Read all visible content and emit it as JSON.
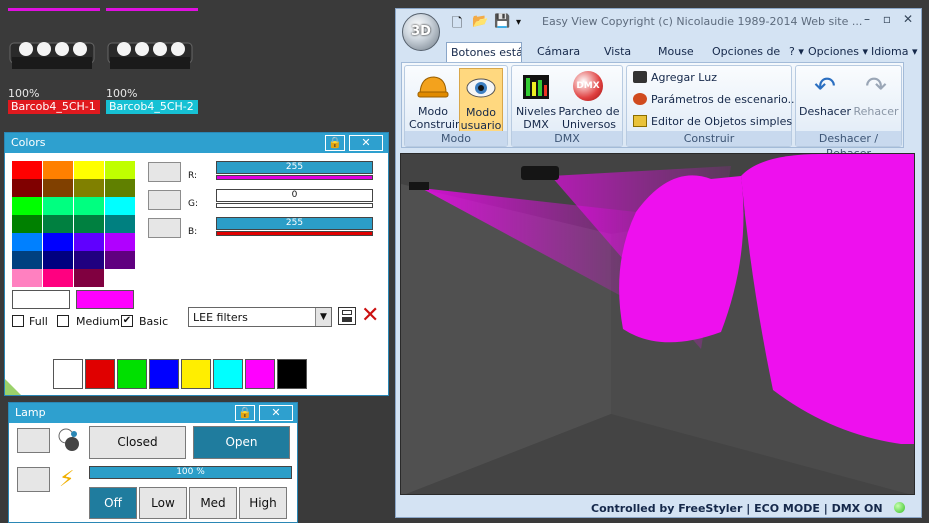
{
  "fixtures": [
    {
      "percent": "100%",
      "name": "Barcob4_5CH-1",
      "label_color": "#e0191e"
    },
    {
      "percent": "100%",
      "name": "Barcob4_5CH-2",
      "label_color": "#17c1d4"
    }
  ],
  "colors_panel": {
    "title": "Colors",
    "pin_icon": "lock-icon",
    "close_label": "✕",
    "palette": [
      "#ff0000",
      "#ff8000",
      "#ffff00",
      "#c0ff00",
      "#800000",
      "#804000",
      "#808000",
      "#608000",
      "#00ff00",
      "#00ff80",
      "#00ff80",
      "#00ffff",
      "#008000",
      "#008040",
      "#008040",
      "#008080",
      "#0080ff",
      "#0000ff",
      "#6000ff",
      "#b000ff",
      "#004080",
      "#000080",
      "#200080",
      "#600080",
      "#ff80c0",
      "#ff0080",
      "#800040",
      "#ffffff"
    ],
    "r_label": "R:",
    "g_label": "G:",
    "b_label": "B:",
    "r_value": "255",
    "g_value": "0",
    "b_value": "255",
    "current_color": "#ff00ff",
    "checkboxes": [
      {
        "label": "Full",
        "checked": false
      },
      {
        "label": "Medium",
        "checked": false
      },
      {
        "label": "Basic",
        "checked": true
      }
    ],
    "filter_select": "LEE filters",
    "quick_colors": [
      "#ffffff",
      "#e00000",
      "#00e000",
      "#0000ff",
      "#ffee00",
      "#00ffff",
      "#ff00ff",
      "#000000"
    ]
  },
  "lamp_panel": {
    "title": "Lamp",
    "closed_label": "Closed",
    "open_label": "Open",
    "progress": "100 %",
    "off_label": "Off",
    "low_label": "Low",
    "med_label": "Med",
    "high_label": "High"
  },
  "window": {
    "orb_label": "3D",
    "title": "Easy View   Copyright (c) Nicolaudie 1989-2014   Web site ...",
    "tabs": [
      "Botones están",
      "Cámara",
      "Vista",
      "Mouse",
      "Opciones de c"
    ],
    "right_menu": [
      "?",
      "Opciones",
      "Idioma"
    ],
    "groups": {
      "modo": {
        "caption": "Modo",
        "construir": "Modo\nConstruir",
        "usuario": "Modo\nusuario"
      },
      "dmx": {
        "caption": "DMX",
        "niveles": "Niveles\nDMX",
        "parcheo": "Parcheo de\nUniversos",
        "dmx_logo": "DMX"
      },
      "construir": {
        "caption": "Construir",
        "items": [
          "Agregar Luz",
          "Parámetros de escenario...",
          "Editor de Objetos simples"
        ]
      },
      "deshacer": {
        "caption": "Deshacer / Rehacer",
        "undo": "Deshacer",
        "redo": "Rehacer"
      }
    },
    "status": {
      "controlled": "Controlled by FreeStyler",
      "eco": "ECO MODE",
      "dmx": "DMX ON"
    }
  },
  "beam_color": "#ff00ff"
}
